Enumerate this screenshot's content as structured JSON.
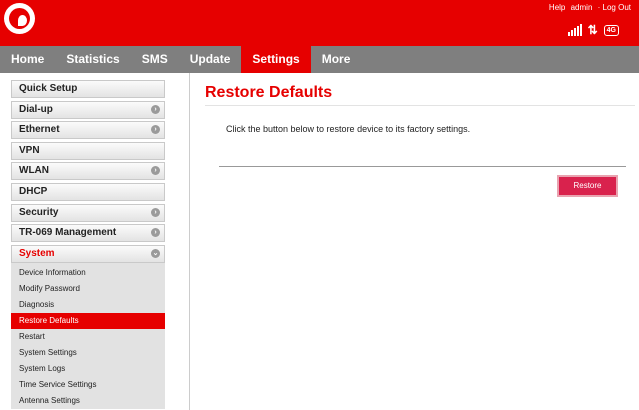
{
  "header": {
    "links": [
      "Help",
      "admin",
      "· Log Out"
    ],
    "network": "4G"
  },
  "nav": {
    "items": [
      "Home",
      "Statistics",
      "SMS",
      "Update",
      "Settings",
      "More"
    ]
  },
  "sidebar": {
    "items": [
      {
        "label": "Quick Setup"
      },
      {
        "label": "Dial-up"
      },
      {
        "label": "Ethernet"
      },
      {
        "label": "VPN"
      },
      {
        "label": "WLAN"
      },
      {
        "label": "DHCP"
      },
      {
        "label": "Security"
      },
      {
        "label": "TR-069 Management"
      },
      {
        "label": "System"
      }
    ],
    "system_sub": [
      "Device Information",
      "Modify Password",
      "Diagnosis",
      "Restore Defaults",
      "Restart",
      "System Settings",
      "System Logs",
      "Time Service Settings",
      "Antenna Settings"
    ]
  },
  "main": {
    "title": "Restore Defaults",
    "description": "Click the button below to restore device to its factory settings.",
    "button_label": "Restore"
  }
}
